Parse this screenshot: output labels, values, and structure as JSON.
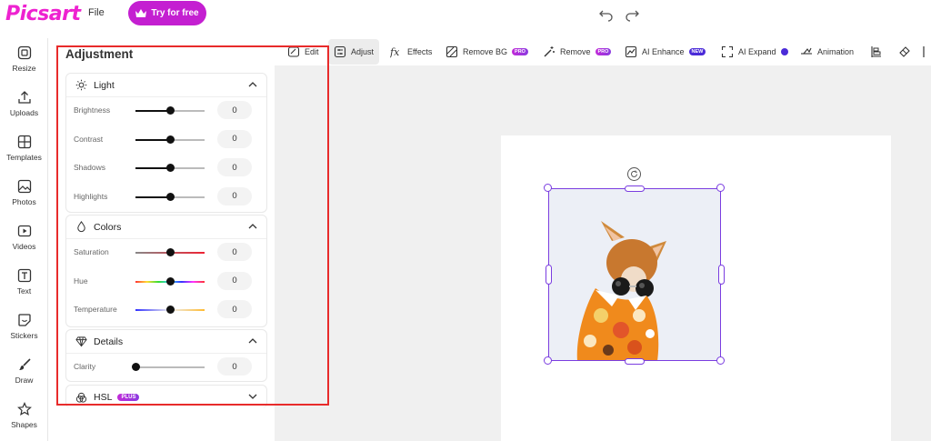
{
  "app": {
    "logo": "Picsart",
    "file_menu": "File",
    "try_button": "Try for free"
  },
  "rail": {
    "items": [
      {
        "label": "Resize",
        "icon": "resize-icon"
      },
      {
        "label": "Uploads",
        "icon": "upload-icon"
      },
      {
        "label": "Templates",
        "icon": "templates-icon"
      },
      {
        "label": "Photos",
        "icon": "photo-icon"
      },
      {
        "label": "Videos",
        "icon": "video-icon"
      },
      {
        "label": "Text",
        "icon": "text-icon"
      },
      {
        "label": "Stickers",
        "icon": "sticker-icon"
      },
      {
        "label": "Draw",
        "icon": "brush-icon"
      },
      {
        "label": "Shapes",
        "icon": "star-icon"
      }
    ]
  },
  "panel": {
    "title": "Adjustment",
    "light": {
      "title": "Light",
      "rows": [
        {
          "label": "Brightness",
          "value": "0",
          "level": 0.5
        },
        {
          "label": "Contrast",
          "value": "0",
          "level": 0.5
        },
        {
          "label": "Shadows",
          "value": "0",
          "level": 0.5
        },
        {
          "label": "Highlights",
          "value": "0",
          "level": 0.5
        }
      ]
    },
    "colors": {
      "title": "Colors",
      "rows": [
        {
          "label": "Saturation",
          "value": "0",
          "level": 0.5
        },
        {
          "label": "Hue",
          "value": "0",
          "level": 0.5
        },
        {
          "label": "Temperature",
          "value": "0",
          "level": 0.5
        }
      ]
    },
    "details": {
      "title": "Details",
      "rows": [
        {
          "label": "Clarity",
          "value": "0",
          "level": 0.0
        }
      ]
    },
    "hsl": {
      "title": "HSL",
      "badge": "PLUS"
    }
  },
  "toolbar": {
    "edit": "Edit",
    "adjust": "Adjust",
    "effects": "Effects",
    "remove_bg": "Remove BG",
    "remove": "Remove",
    "ai_enhance": "AI Enhance",
    "ai_expand": "AI Expand",
    "animation": "Animation",
    "pro_badge": "PRO",
    "new_badge": "NEW"
  },
  "colors": {
    "brand": "#c41fd1",
    "selection": "#7a3de0",
    "highlight_box": "#e82b2b"
  }
}
